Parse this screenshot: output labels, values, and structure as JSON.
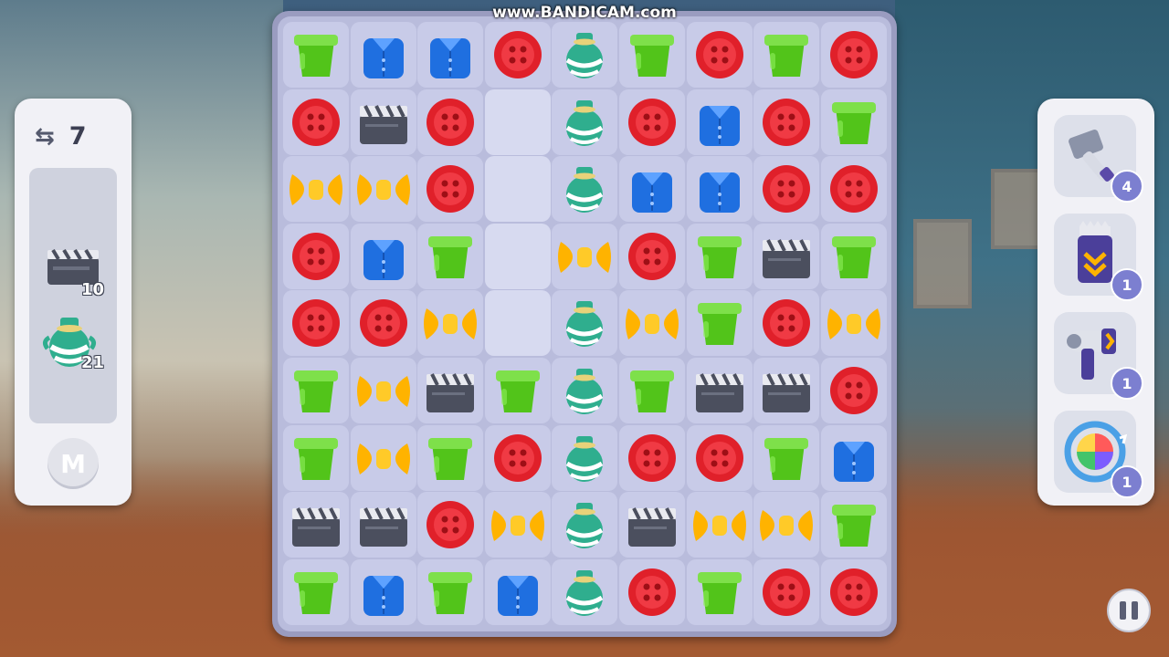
{
  "watermark": "www.BANDICAM.com",
  "hud": {
    "moves_left": "7",
    "goals": [
      {
        "icon": "clapperboard-icon",
        "count": "10"
      },
      {
        "icon": "vase-icon",
        "count": "21"
      }
    ],
    "menu_button": "M"
  },
  "boosters": [
    {
      "icon": "hammer-icon",
      "count": "4"
    },
    {
      "icon": "shredder-icon",
      "count": "1"
    },
    {
      "icon": "hair-dryer-icon",
      "count": "1"
    },
    {
      "icon": "shuffle-rainbow-icon",
      "count": "1"
    }
  ],
  "piece_legend": {
    "G": "green-pot-icon",
    "S": "blue-shirt-icon",
    "R": "red-button-icon",
    "Y": "yellow-bow-icon",
    "C": "clapperboard-icon",
    "V": "vase-icon",
    "X": "empty-cell"
  },
  "board": [
    [
      "G",
      "S",
      "S",
      "R",
      "V",
      "G",
      "R",
      "G",
      "R"
    ],
    [
      "R",
      "C",
      "R",
      "X",
      "V",
      "R",
      "S",
      "R",
      "G"
    ],
    [
      "Y",
      "Y",
      "R",
      "X",
      "V",
      "S",
      "S",
      "R",
      "R"
    ],
    [
      "R",
      "S",
      "G",
      "X",
      "Y",
      "R",
      "G",
      "C",
      "G"
    ],
    [
      "R",
      "R",
      "Y",
      "X",
      "V",
      "Y",
      "G",
      "R",
      "Y"
    ],
    [
      "G",
      "Y",
      "C",
      "G",
      "V",
      "G",
      "C",
      "C",
      "R"
    ],
    [
      "G",
      "Y",
      "G",
      "R",
      "V",
      "R",
      "R",
      "G",
      "S"
    ],
    [
      "C",
      "C",
      "R",
      "Y",
      "V",
      "C",
      "Y",
      "Y",
      "G"
    ],
    [
      "G",
      "S",
      "G",
      "S",
      "V",
      "R",
      "G",
      "R",
      "R"
    ]
  ],
  "colors": {
    "green": "#52c41a",
    "blue": "#1f6fe0",
    "red": "#e0202a",
    "yellow": "#ffb300",
    "clapper": "#4b4f5e",
    "vase": "#2fae8e"
  }
}
